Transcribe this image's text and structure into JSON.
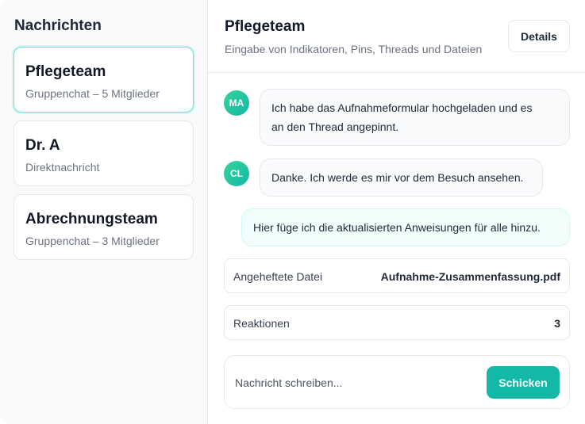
{
  "sidebar": {
    "title": "Nachrichten",
    "conversations": [
      {
        "name": "Pflegeteam",
        "subtitle": "Gruppenchat – 5 Mitglieder",
        "active": true
      },
      {
        "name": "Dr. A",
        "subtitle": "Direktnachricht",
        "active": false
      },
      {
        "name": "Abrechnungsteam",
        "subtitle": "Gruppenchat – 3 Mitglieder",
        "active": false
      }
    ]
  },
  "header": {
    "title": "Pflegeteam",
    "subtitle": "Eingabe von Indikatoren, Pins, Threads und Dateien",
    "details_label": "Details"
  },
  "messages": [
    {
      "initials": "MA",
      "lines": [
        "Ich habe das Aufnahmeformular hochgeladen und es",
        "an den Thread angepinnt."
      ],
      "mine": false
    },
    {
      "initials": "CL",
      "lines": [
        "Danke. Ich werde es mir vor dem Besuch ansehen."
      ],
      "mine": false
    },
    {
      "initials": "",
      "lines": [
        "Hier füge ich die aktualisierten Anweisungen für alle hinzu."
      ],
      "mine": true
    }
  ],
  "pinned": {
    "label": "Angeheftete Datei",
    "value": "Aufnahme-Zusammenfassung.pdf"
  },
  "reactions": {
    "label": "Reaktionen",
    "value": "3"
  },
  "composer": {
    "placeholder": "Nachricht schreiben...",
    "value": "",
    "send_label": "Schicken"
  },
  "colors": {
    "accent": "#14b8a6",
    "active_border": "#5eead4",
    "mine_bubble": "#f0fdfa"
  }
}
